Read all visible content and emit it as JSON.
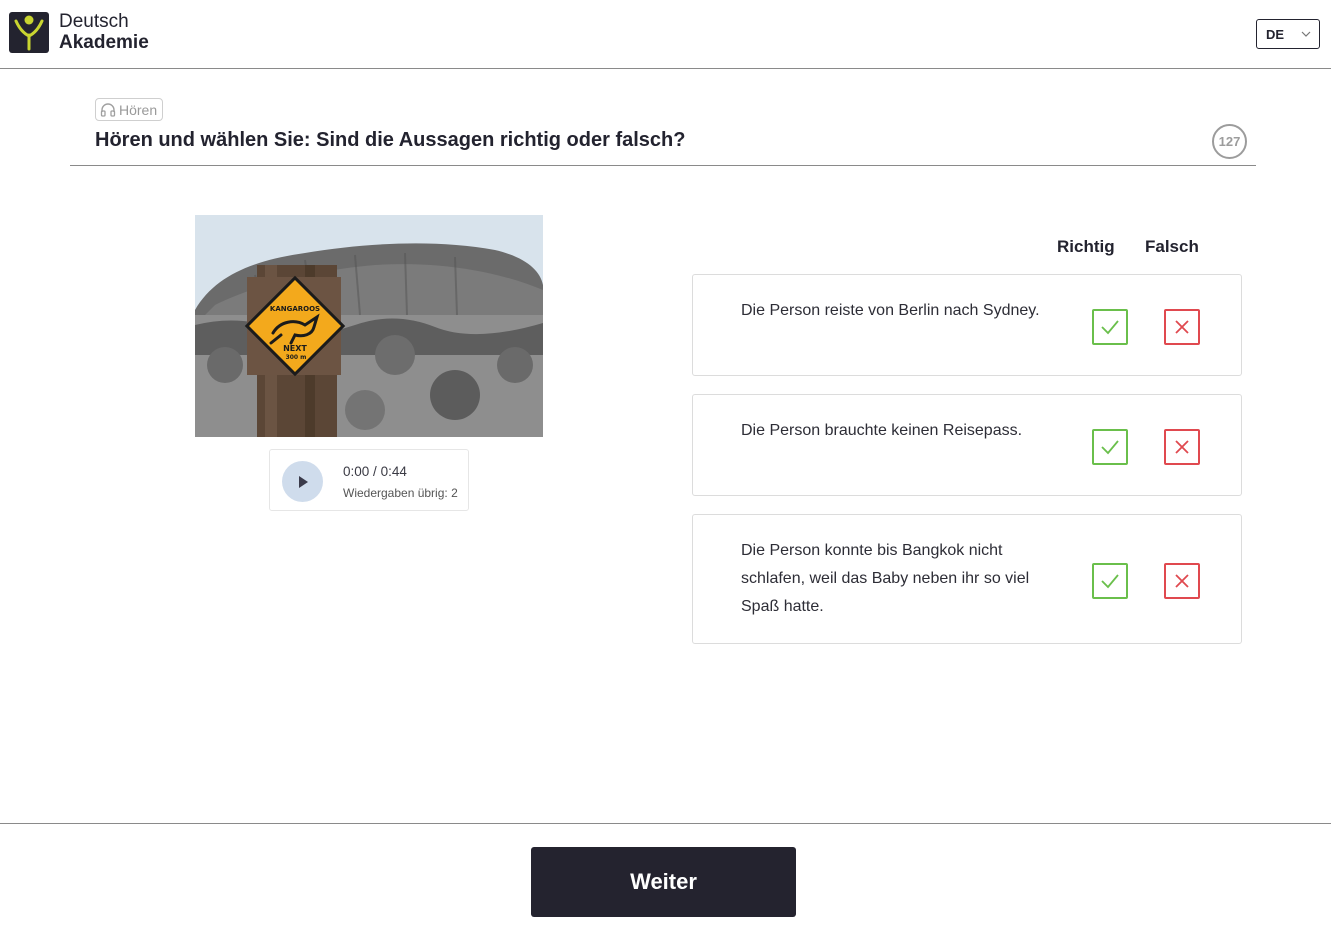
{
  "brand": {
    "line1": "Deutsch",
    "line2": "Akademie",
    "accent_color": "#c9d530"
  },
  "language": {
    "selected": "DE"
  },
  "task": {
    "skill_label": "Hören",
    "skill_icon": "headphones-icon",
    "title": "Hören und wählen Sie: Sind die Aussagen richtig oder falsch?",
    "number": "127"
  },
  "image": {
    "sign_line1": "KANGAROOS",
    "sign_line2": "NEXT",
    "sign_line3": "300 m"
  },
  "audio": {
    "current": "0:00",
    "separator": "/",
    "duration": "0:44",
    "remaining_label": "Wiedergaben übrig: 2"
  },
  "columns": {
    "true_label": "Richtig",
    "false_label": "Falsch"
  },
  "statements": [
    {
      "text": "Die Person reiste von Berlin nach Sydney."
    },
    {
      "text": "Die Person brauchte keinen Reisepass."
    },
    {
      "text": "Die Person konnte bis Bangkok nicht schlafen, weil das Baby neben ihr so viel Spaß hatte."
    }
  ],
  "footer": {
    "next_label": "Weiter"
  },
  "colors": {
    "primary_dark": "#24232f",
    "true_green": "#6abf4b",
    "false_red": "#e0494f",
    "play_button_bg": "#cfdcec"
  }
}
